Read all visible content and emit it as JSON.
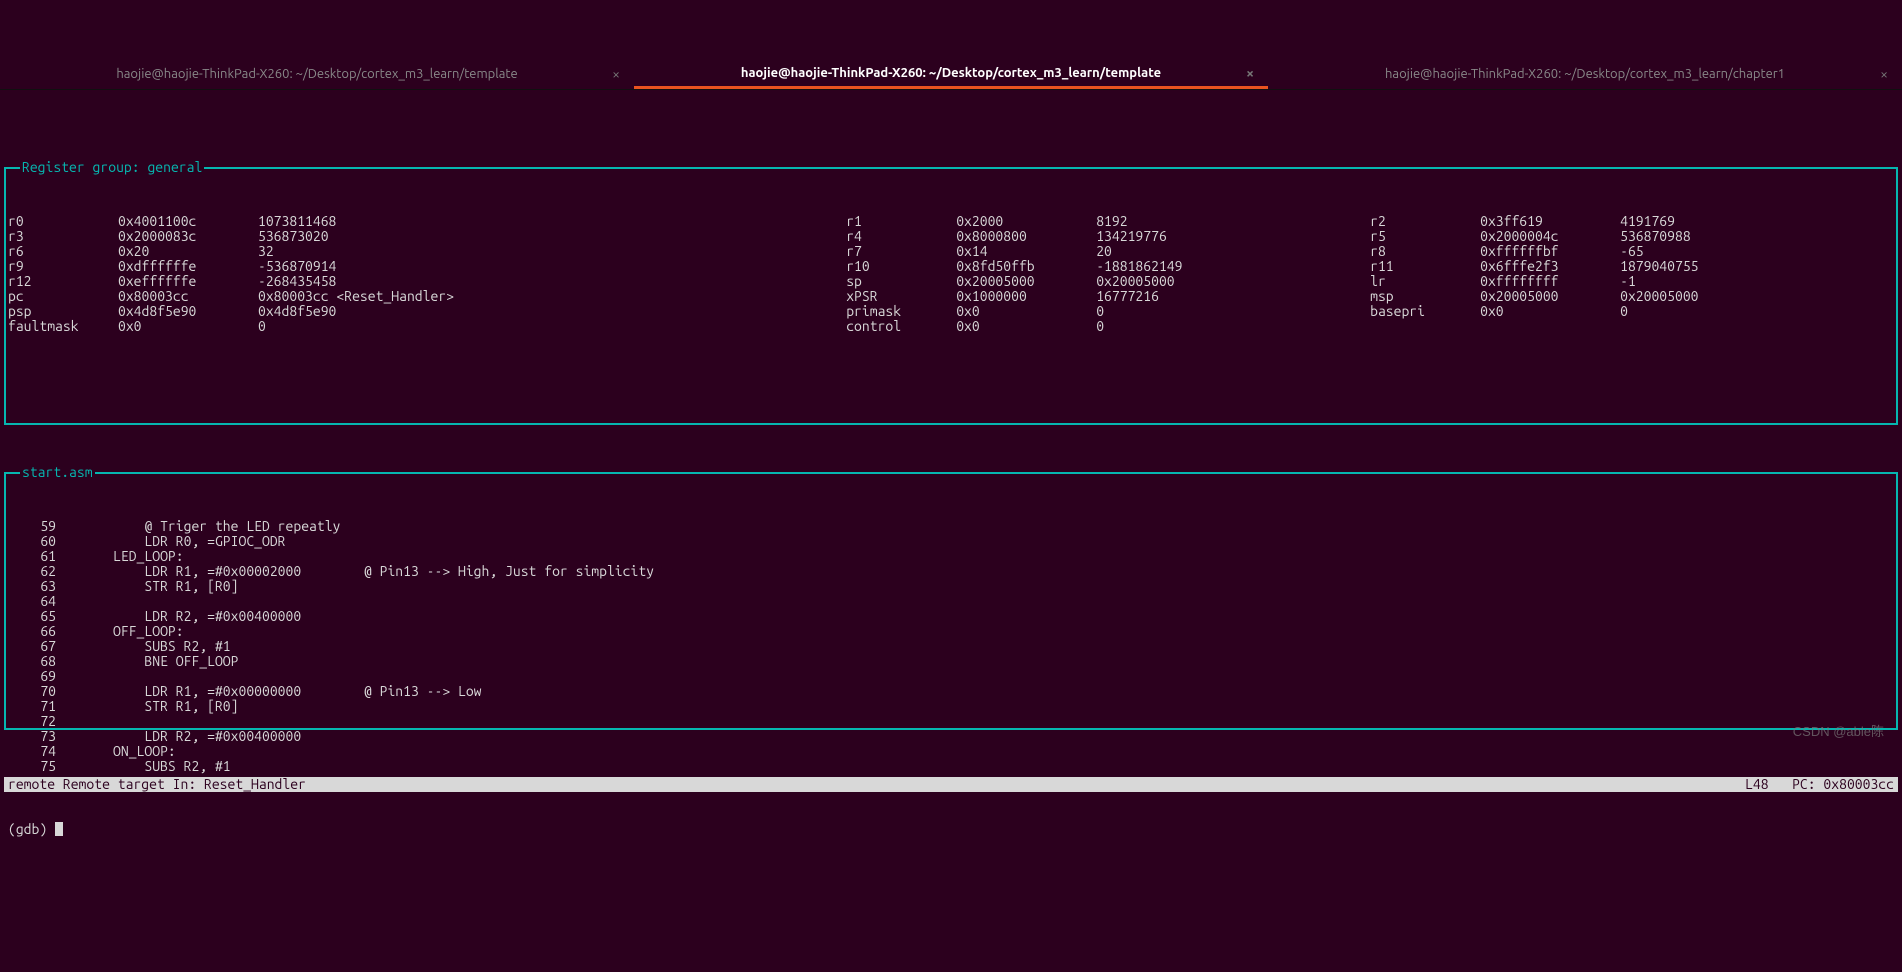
{
  "tabs": [
    {
      "title": "haojie@haojie-ThinkPad-X260: ~/Desktop/cortex_m3_learn/template",
      "active": false
    },
    {
      "title": "haojie@haojie-ThinkPad-X260: ~/Desktop/cortex_m3_learn/template",
      "active": true
    },
    {
      "title": "haojie@haojie-ThinkPad-X260: ~/Desktop/cortex_m3_learn/chapter1",
      "active": false
    }
  ],
  "close_glyph": "×",
  "reg_panel_title": "Register group: general",
  "registers": [
    [
      {
        "name": "r0",
        "hex": "0x4001100c",
        "dec": "1073811468"
      },
      {
        "name": "r1",
        "hex": "0x2000",
        "dec": "8192"
      },
      {
        "name": "r2",
        "hex": "0x3ff619",
        "dec": "4191769"
      }
    ],
    [
      {
        "name": "r3",
        "hex": "0x2000083c",
        "dec": "536873020"
      },
      {
        "name": "r4",
        "hex": "0x8000800",
        "dec": "134219776"
      },
      {
        "name": "r5",
        "hex": "0x2000004c",
        "dec": "536870988"
      }
    ],
    [
      {
        "name": "r6",
        "hex": "0x20",
        "dec": "32"
      },
      {
        "name": "r7",
        "hex": "0x14",
        "dec": "20"
      },
      {
        "name": "r8",
        "hex": "0xffffffbf",
        "dec": "-65"
      }
    ],
    [
      {
        "name": "r9",
        "hex": "0xdffffffe",
        "dec": "-536870914"
      },
      {
        "name": "r10",
        "hex": "0x8fd50ffb",
        "dec": "-1881862149"
      },
      {
        "name": "r11",
        "hex": "0x6fffe2f3",
        "dec": "1879040755"
      }
    ],
    [
      {
        "name": "r12",
        "hex": "0xeffffffe",
        "dec": "-268435458"
      },
      {
        "name": "sp",
        "hex": "0x20005000",
        "dec": "0x20005000"
      },
      {
        "name": "lr",
        "hex": "0xffffffff",
        "dec": "-1"
      }
    ],
    [
      {
        "name": "pc",
        "hex": "0x80003cc",
        "dec": "0x80003cc <Reset_Handler>",
        "wide": true
      },
      {
        "name": "xPSR",
        "hex": "0x1000000",
        "dec": "16777216"
      },
      {
        "name": "msp",
        "hex": "0x20005000",
        "dec": "0x20005000"
      }
    ],
    [
      {
        "name": "psp",
        "hex": "0x4d8f5e90",
        "dec": "0x4d8f5e90"
      },
      {
        "name": "primask",
        "hex": "0x0",
        "dec": "0"
      },
      {
        "name": "basepri",
        "hex": "0x0",
        "dec": "0"
      }
    ],
    [
      {
        "name": "faultmask",
        "hex": "0x0",
        "dec": "0"
      },
      {
        "name": "control",
        "hex": "0x0",
        "dec": "0"
      },
      {
        "name": "",
        "hex": "",
        "dec": ""
      }
    ]
  ],
  "src_panel_title": "start.asm",
  "source": [
    {
      "no": "59",
      "text": "          @ Triger the LED repeatly"
    },
    {
      "no": "60",
      "text": "          LDR R0, =GPIOC_ODR"
    },
    {
      "no": "61",
      "text": "      LED_LOOP:"
    },
    {
      "no": "62",
      "text": "          LDR R1, =#0x00002000        @ Pin13 --> High, Just for simplicity"
    },
    {
      "no": "63",
      "text": "          STR R1, [R0]"
    },
    {
      "no": "64",
      "text": ""
    },
    {
      "no": "65",
      "text": "          LDR R2, =#0x00400000"
    },
    {
      "no": "66",
      "text": "      OFF_LOOP:"
    },
    {
      "no": "67",
      "text": "          SUBS R2, #1"
    },
    {
      "no": "68",
      "text": "          BNE OFF_LOOP"
    },
    {
      "no": "69",
      "text": ""
    },
    {
      "no": "70",
      "text": "          LDR R1, =#0x00000000        @ Pin13 --> Low"
    },
    {
      "no": "71",
      "text": "          STR R1, [R0]"
    },
    {
      "no": "72",
      "text": ""
    },
    {
      "no": "73",
      "text": "          LDR R2, =#0x00400000"
    },
    {
      "no": "74",
      "text": "      ON_LOOP:"
    },
    {
      "no": "75",
      "text": "          SUBS R2, #1"
    }
  ],
  "status_left": "remote Remote target In: Reset_Handler",
  "status_right": "L48   PC: 0x80003cc",
  "prompt": "(gdb) ",
  "watermark": "CSDN @able陈"
}
